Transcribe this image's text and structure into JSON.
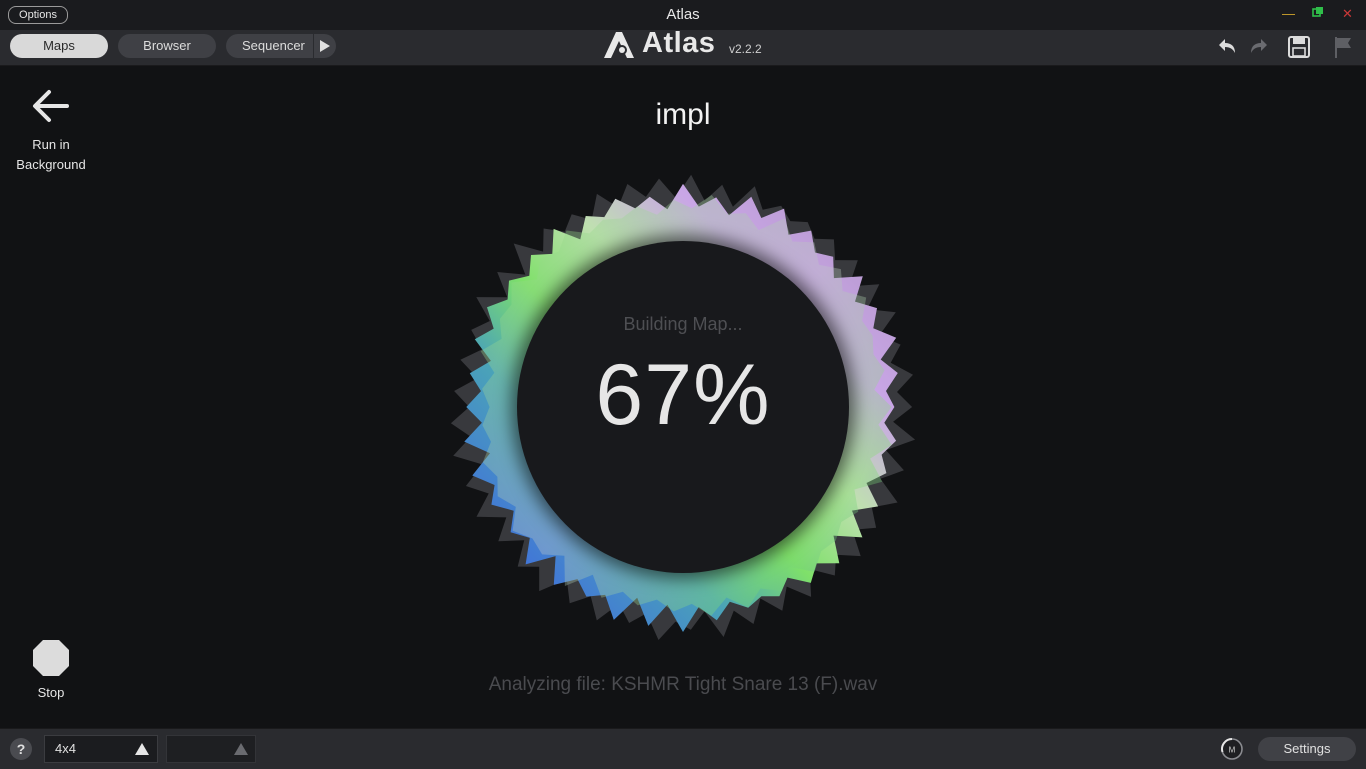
{
  "window": {
    "title": "Atlas",
    "options_label": "Options"
  },
  "toolbar": {
    "tabs": [
      {
        "label": "Maps",
        "active": true
      },
      {
        "label": "Browser"
      },
      {
        "label": "Sequencer"
      }
    ],
    "logo": {
      "name": "Atlas",
      "version": "v2.2.2"
    },
    "icons": [
      "undo-icon",
      "redo-icon",
      "save-icon",
      "flag-icon"
    ]
  },
  "main": {
    "back": {
      "label": "Run in Background",
      "icon": "arrow-left-icon"
    },
    "map_title": "impl",
    "progress": {
      "status": "Building Map...",
      "percent_text": "67%",
      "percent": 67
    },
    "stop": {
      "label": "Stop",
      "icon": "stop-octagon-icon"
    },
    "analyzing_text": "Analyzing file: KSHMR Tight Snare 13 (F).wav"
  },
  "statusbar": {
    "help_label": "?",
    "grid_value": "4x4",
    "second_value": "",
    "midi_label": "M",
    "settings_label": "Settings"
  },
  "colors": {
    "background": "#111214",
    "bar": "#2a2b2f",
    "ring_purple": "#c9a6e6",
    "ring_green": "#7fe06a",
    "ring_blue": "#3f6ae0"
  }
}
